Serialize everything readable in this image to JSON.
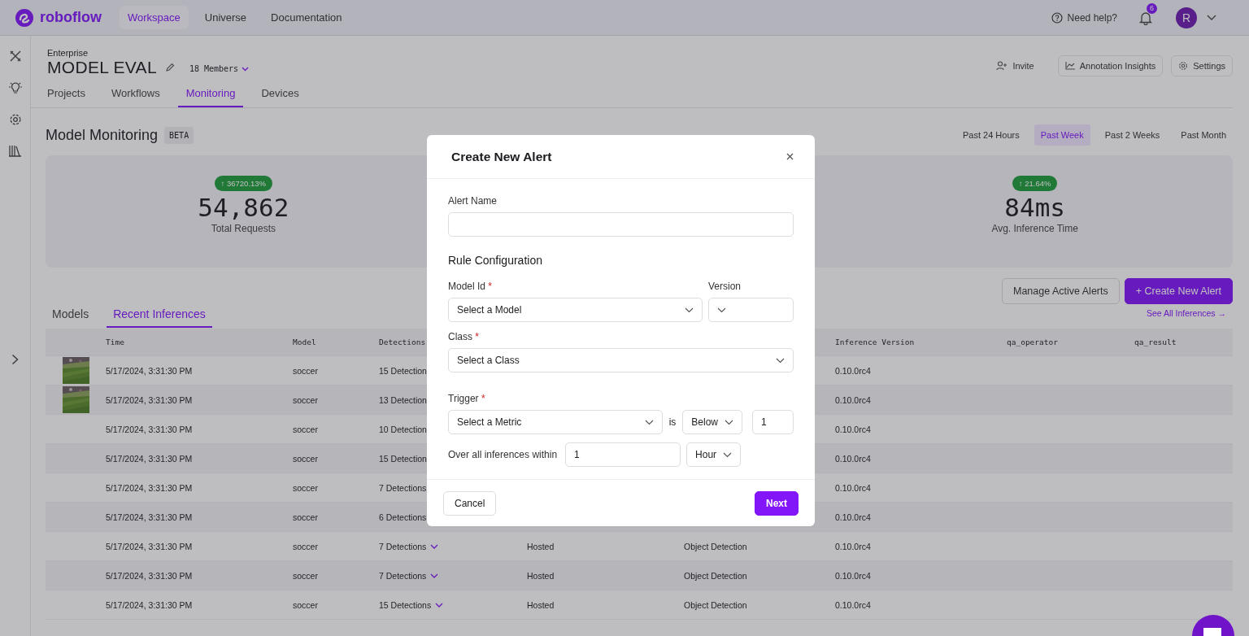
{
  "nav": {
    "logo": "roboflow",
    "links": [
      {
        "label": "Workspace",
        "selected": true
      },
      {
        "label": "Universe",
        "selected": false
      },
      {
        "label": "Documentation",
        "selected": false
      }
    ],
    "help": "Need help?",
    "notifications": "6",
    "avatar": "R"
  },
  "workspace": {
    "plan": "Enterprise",
    "name": "MODEL EVAL",
    "members": "18 Members",
    "actions": [
      {
        "label": "Invite",
        "kind": "link"
      },
      {
        "label": "Annotation Insights",
        "kind": "chart"
      },
      {
        "label": "Settings",
        "kind": "gear"
      }
    ],
    "tabs": [
      {
        "label": "Projects",
        "selected": false
      },
      {
        "label": "Workflows",
        "selected": false
      },
      {
        "label": "Monitoring",
        "selected": true
      },
      {
        "label": "Devices",
        "selected": false
      }
    ]
  },
  "monitoring": {
    "title": "Model Monitoring",
    "badge": "BETA",
    "ranges": [
      {
        "label": "Past 24 Hours",
        "selected": false
      },
      {
        "label": "Past Week",
        "selected": true
      },
      {
        "label": "Past 2 Weeks",
        "selected": false
      },
      {
        "label": "Past Month",
        "selected": false
      }
    ],
    "stats": [
      {
        "change": "↑ 36720.13%",
        "value": "54,862",
        "label": "Total Requests"
      },
      {
        "change": "↑ 21.64%",
        "value": "84ms",
        "label": "Avg. Inference Time"
      }
    ],
    "manage_button": "Manage Active Alerts",
    "create_button": "+ Create New Alert",
    "tabs": [
      {
        "label": "Models",
        "selected": false
      },
      {
        "label": "Recent Inferences",
        "selected": true
      }
    ],
    "see_all": "See All Inferences →"
  },
  "table": {
    "columns": [
      "Time",
      "Model",
      "Detections",
      "Inference Version",
      "qa_operator",
      "qa_result"
    ],
    "rows": [
      {
        "thumbnail": true,
        "time": "5/17/2024, 3:31:30 PM",
        "model": "soccer",
        "detections": "15 Detection",
        "has_caret": false,
        "version": "0.10.0rc4"
      },
      {
        "thumbnail": true,
        "time": "5/17/2024, 3:31:30 PM",
        "model": "soccer",
        "detections": "13 Detection",
        "has_caret": false,
        "version": "0.10.0rc4"
      },
      {
        "thumbnail": false,
        "time": "5/17/2024, 3:31:30 PM",
        "model": "soccer",
        "detections": "10 Detection",
        "version": "0.10.0rc4"
      },
      {
        "thumbnail": false,
        "time": "5/17/2024, 3:31:30 PM",
        "model": "soccer",
        "detections": "15 Detection",
        "version": "0.10.0rc4"
      },
      {
        "thumbnail": false,
        "time": "5/17/2024, 3:31:30 PM",
        "model": "soccer",
        "detections": "7 Detections",
        "version": "0.10.0rc4"
      },
      {
        "thumbnail": false,
        "time": "5/17/2024, 3:31:30 PM",
        "model": "soccer",
        "detections": "6 Detections",
        "version": "0.10.0rc4"
      },
      {
        "thumbnail": false,
        "time": "5/17/2024, 3:31:30 PM",
        "model": "soccer",
        "detections": "7 Detections",
        "has_caret": true,
        "deployment": "Hosted",
        "task": "Object Detection",
        "version": "0.10.0rc4"
      },
      {
        "thumbnail": false,
        "time": "5/17/2024, 3:31:30 PM",
        "model": "soccer",
        "detections": "7 Detections",
        "has_caret": true,
        "deployment": "Hosted",
        "task": "Object Detection",
        "version": "0.10.0rc4"
      },
      {
        "thumbnail": false,
        "time": "5/17/2024, 3:31:30 PM",
        "model": "soccer",
        "detections": "15 Detections",
        "has_caret": true,
        "deployment": "Hosted",
        "task": "Object Detection",
        "version": "0.10.0rc4"
      }
    ]
  },
  "modal": {
    "title": "Create New Alert",
    "alert_name": {
      "label": "Alert Name"
    },
    "section": "Rule Configuration",
    "model_id": {
      "label": "Model Id",
      "required_mark": "*",
      "value": "Select a Model"
    },
    "version": {
      "label": "Version"
    },
    "class": {
      "label": "Class",
      "required_mark": "*",
      "value": "Select a Class"
    },
    "trigger": {
      "label": "Trigger",
      "required_mark": "*",
      "metric": "Select a Metric",
      "is": "is",
      "comparator": "Below",
      "threshold": "1"
    },
    "window": {
      "label": "Over all inferences within",
      "value": "1",
      "unit": "Hour"
    },
    "cancel": "Cancel",
    "next": "Next"
  }
}
